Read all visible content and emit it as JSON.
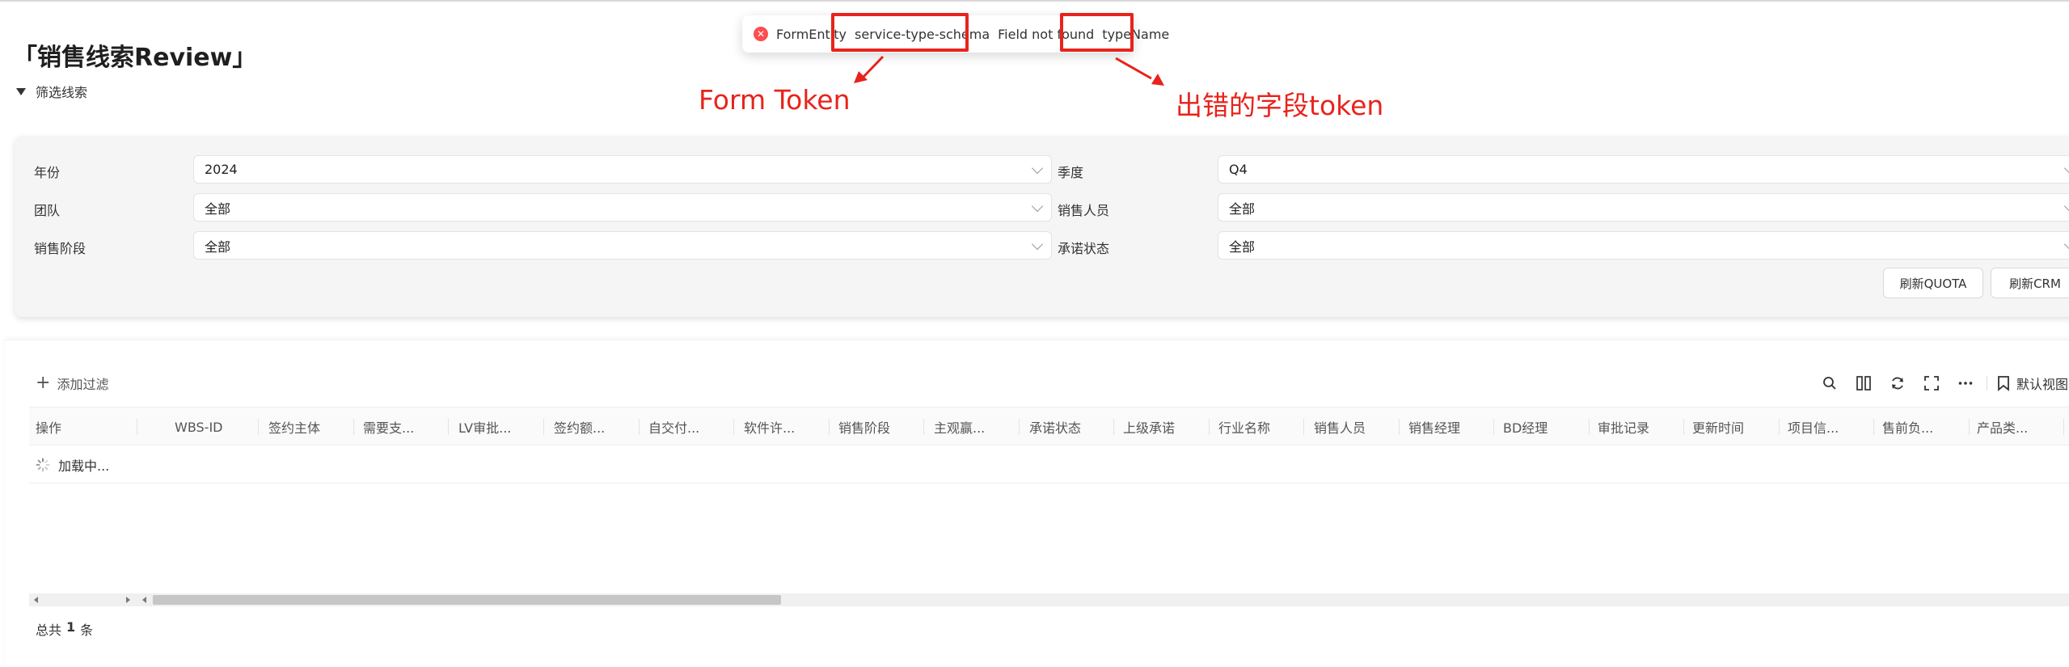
{
  "page": {
    "title": "「销售线索Review」",
    "filter_toggle_label": "筛选线索"
  },
  "filters": {
    "year": {
      "label": "年份",
      "value": "2024"
    },
    "quarter": {
      "label": "季度",
      "value": "Q4"
    },
    "team": {
      "label": "团队",
      "value": "全部"
    },
    "salesperson": {
      "label": "销售人员",
      "value": "全部"
    },
    "stage": {
      "label": "销售阶段",
      "value": "全部"
    },
    "commit_status": {
      "label": "承诺状态",
      "value": "全部"
    },
    "refresh_quota_label": "刷新QUOTA",
    "refresh_crm_label": "刷新CRM"
  },
  "toolbar": {
    "add_filter_label": "添加过滤",
    "default_view_label": "默认视图",
    "icons": [
      "search-icon",
      "columns-icon",
      "refresh-icon",
      "fullscreen-icon",
      "more-icon",
      "bookmark-icon"
    ]
  },
  "table": {
    "columns": [
      "操作",
      "WBS-ID",
      "签约主体",
      "需要支...",
      "LV审批...",
      "签约额...",
      "自交付...",
      "软件许...",
      "销售阶段",
      "主观赢...",
      "承诺状态",
      "上级承诺",
      "行业名称",
      "销售人员",
      "销售经理",
      "BD经理",
      "审批记录",
      "更新时间",
      "项目信...",
      "售前负...",
      "产品类..."
    ],
    "loading_text": "加载中...",
    "total_prefix": "总共",
    "total_count": "1",
    "total_suffix": "条"
  },
  "toast": {
    "part1": "FormEntity",
    "part2": "service-type-schema",
    "part3": "Field not found",
    "part4": "typeName"
  },
  "annotations": {
    "form_token": "Form Token",
    "field_token": "出错的字段token",
    "color": "#e8231c"
  },
  "colors": {
    "error_red": "#ff4d4f",
    "panel_bg": "#f5f5f5"
  }
}
